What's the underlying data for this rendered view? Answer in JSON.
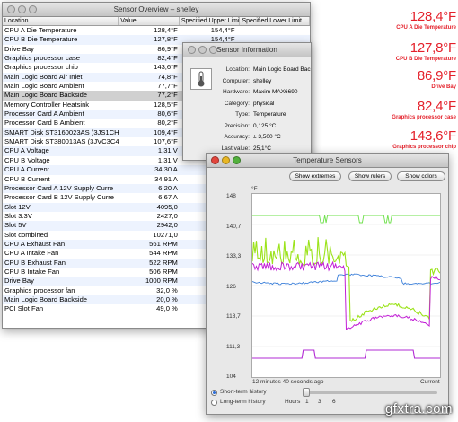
{
  "overview": {
    "title": "Sensor Overview – shelley",
    "columns": [
      "Location",
      "Value",
      "Specified Upper Limit",
      "Specified Lower Limit"
    ],
    "rows": [
      [
        "CPU A Die Temperature",
        "128,4°F",
        "154,4°F",
        ""
      ],
      [
        "CPU B Die Temperature",
        "127,8°F",
        "154,4°F",
        ""
      ],
      [
        "Drive Bay",
        "86,9°F",
        "",
        ""
      ],
      [
        "Graphics processor case",
        "82,4°F",
        "",
        ""
      ],
      [
        "Graphics processor chip",
        "143,6°F",
        "",
        ""
      ],
      [
        "Main Logic Board Air Inlet",
        "74,8°F",
        "",
        ""
      ],
      [
        "Main Logic Board Ambient",
        "77,7°F",
        "",
        ""
      ],
      [
        "Main Logic Board Backside",
        "77,2°F",
        "",
        ""
      ],
      [
        "Memory Controller Heatsink",
        "128,5°F",
        "",
        ""
      ],
      [
        "Processor Card A Ambient",
        "80,6°F",
        "",
        ""
      ],
      [
        "Processor Card B Ambient",
        "80,2°F",
        "",
        ""
      ],
      [
        "SMART Disk ST3160023AS (3JS1CH",
        "109,4°F",
        "",
        ""
      ],
      [
        "SMART Disk ST380013AS (3JVC3C4",
        "107,6°F",
        "",
        ""
      ],
      [
        "CPU A Voltage",
        "1,31 V",
        "",
        ""
      ],
      [
        "CPU B Voltage",
        "1,31 V",
        "",
        ""
      ],
      [
        "CPU A Current",
        "34,30 A",
        "",
        ""
      ],
      [
        "CPU B Current",
        "34,91 A",
        "",
        ""
      ],
      [
        "Processor Card A 12V Supply Curre",
        "6,20 A",
        "",
        ""
      ],
      [
        "Processor Card B 12V Supply Curre",
        "6,67 A",
        "",
        ""
      ],
      [
        "Slot 12V",
        "4095,0",
        "",
        ""
      ],
      [
        "Slot 3.3V",
        "2427,0",
        "",
        ""
      ],
      [
        "Slot 5V",
        "2942,0",
        "",
        ""
      ],
      [
        "Slot combined",
        "10271,0",
        "",
        ""
      ],
      [
        "CPU A Exhaust Fan",
        "561 RPM",
        "",
        ""
      ],
      [
        "CPU A Intake Fan",
        "544 RPM",
        "",
        ""
      ],
      [
        "CPU B Exhaust Fan",
        "522 RPM",
        "",
        ""
      ],
      [
        "CPU B Intake Fan",
        "506 RPM",
        "",
        ""
      ],
      [
        "Drive Bay",
        "1000 RPM",
        "",
        ""
      ],
      [
        "Graphics processor fan",
        "32,0 %",
        "",
        ""
      ],
      [
        "Main Logic Board Backside",
        "20,0 %",
        "",
        ""
      ],
      [
        "PCI Slot Fan",
        "49,0 %",
        "",
        ""
      ]
    ],
    "selected_row": "Main Logic Board Backside"
  },
  "info": {
    "title": "Sensor Information",
    "fields": [
      {
        "key": "Location:",
        "value": "Main Logic Board Backside"
      },
      {
        "key": "Computer:",
        "value": "shelley"
      },
      {
        "key": "Hardware:",
        "value": "Maxim MAX6690"
      },
      {
        "key": "Category:",
        "value": "physical"
      },
      {
        "key": "Type:",
        "value": "Temperature"
      },
      {
        "key": "Precision:",
        "value": "0,125 °C"
      },
      {
        "key": "Accuracy:",
        "value": "± 3,500 °C"
      },
      {
        "key": "Last value:",
        "value": "25,1°C"
      }
    ],
    "icon": "thermometer-icon"
  },
  "temps": {
    "title": "Temperature Sensors",
    "buttons": [
      "Show extremes",
      "Show rulers",
      "Show colors"
    ],
    "unit": "°F",
    "y_ticks": [
      "148",
      "140,7",
      "133,3",
      "126",
      "118,7",
      "111,3",
      "104"
    ],
    "time_label": "12 minutes 40 seconds ago",
    "current_label": "Current",
    "short_term": "Short-term history",
    "long_term": "Long-term history",
    "hours_label": "Hours",
    "hour_ticks": [
      "1",
      "3",
      "6"
    ],
    "selected_history": "short"
  },
  "readouts": [
    {
      "value": "128,4°F",
      "label": "CPU A Die Temperature"
    },
    {
      "value": "127,8°F",
      "label": "CPU B Die Temperature"
    },
    {
      "value": "86,9°F",
      "label": "Drive Bay"
    },
    {
      "value": "82,4°F",
      "label": "Graphics processor case"
    },
    {
      "value": "143,6°F",
      "label": "Graphics processor chip"
    }
  ],
  "watermark": "gfxtra.com",
  "colors": {
    "readout_red": "#e4202a",
    "series_green_top": "#6ee04a",
    "series_lime": "#9be31a",
    "series_magenta": "#c21fd6",
    "series_blue": "#3b7fd9",
    "series_purple": "#b22bd4"
  }
}
